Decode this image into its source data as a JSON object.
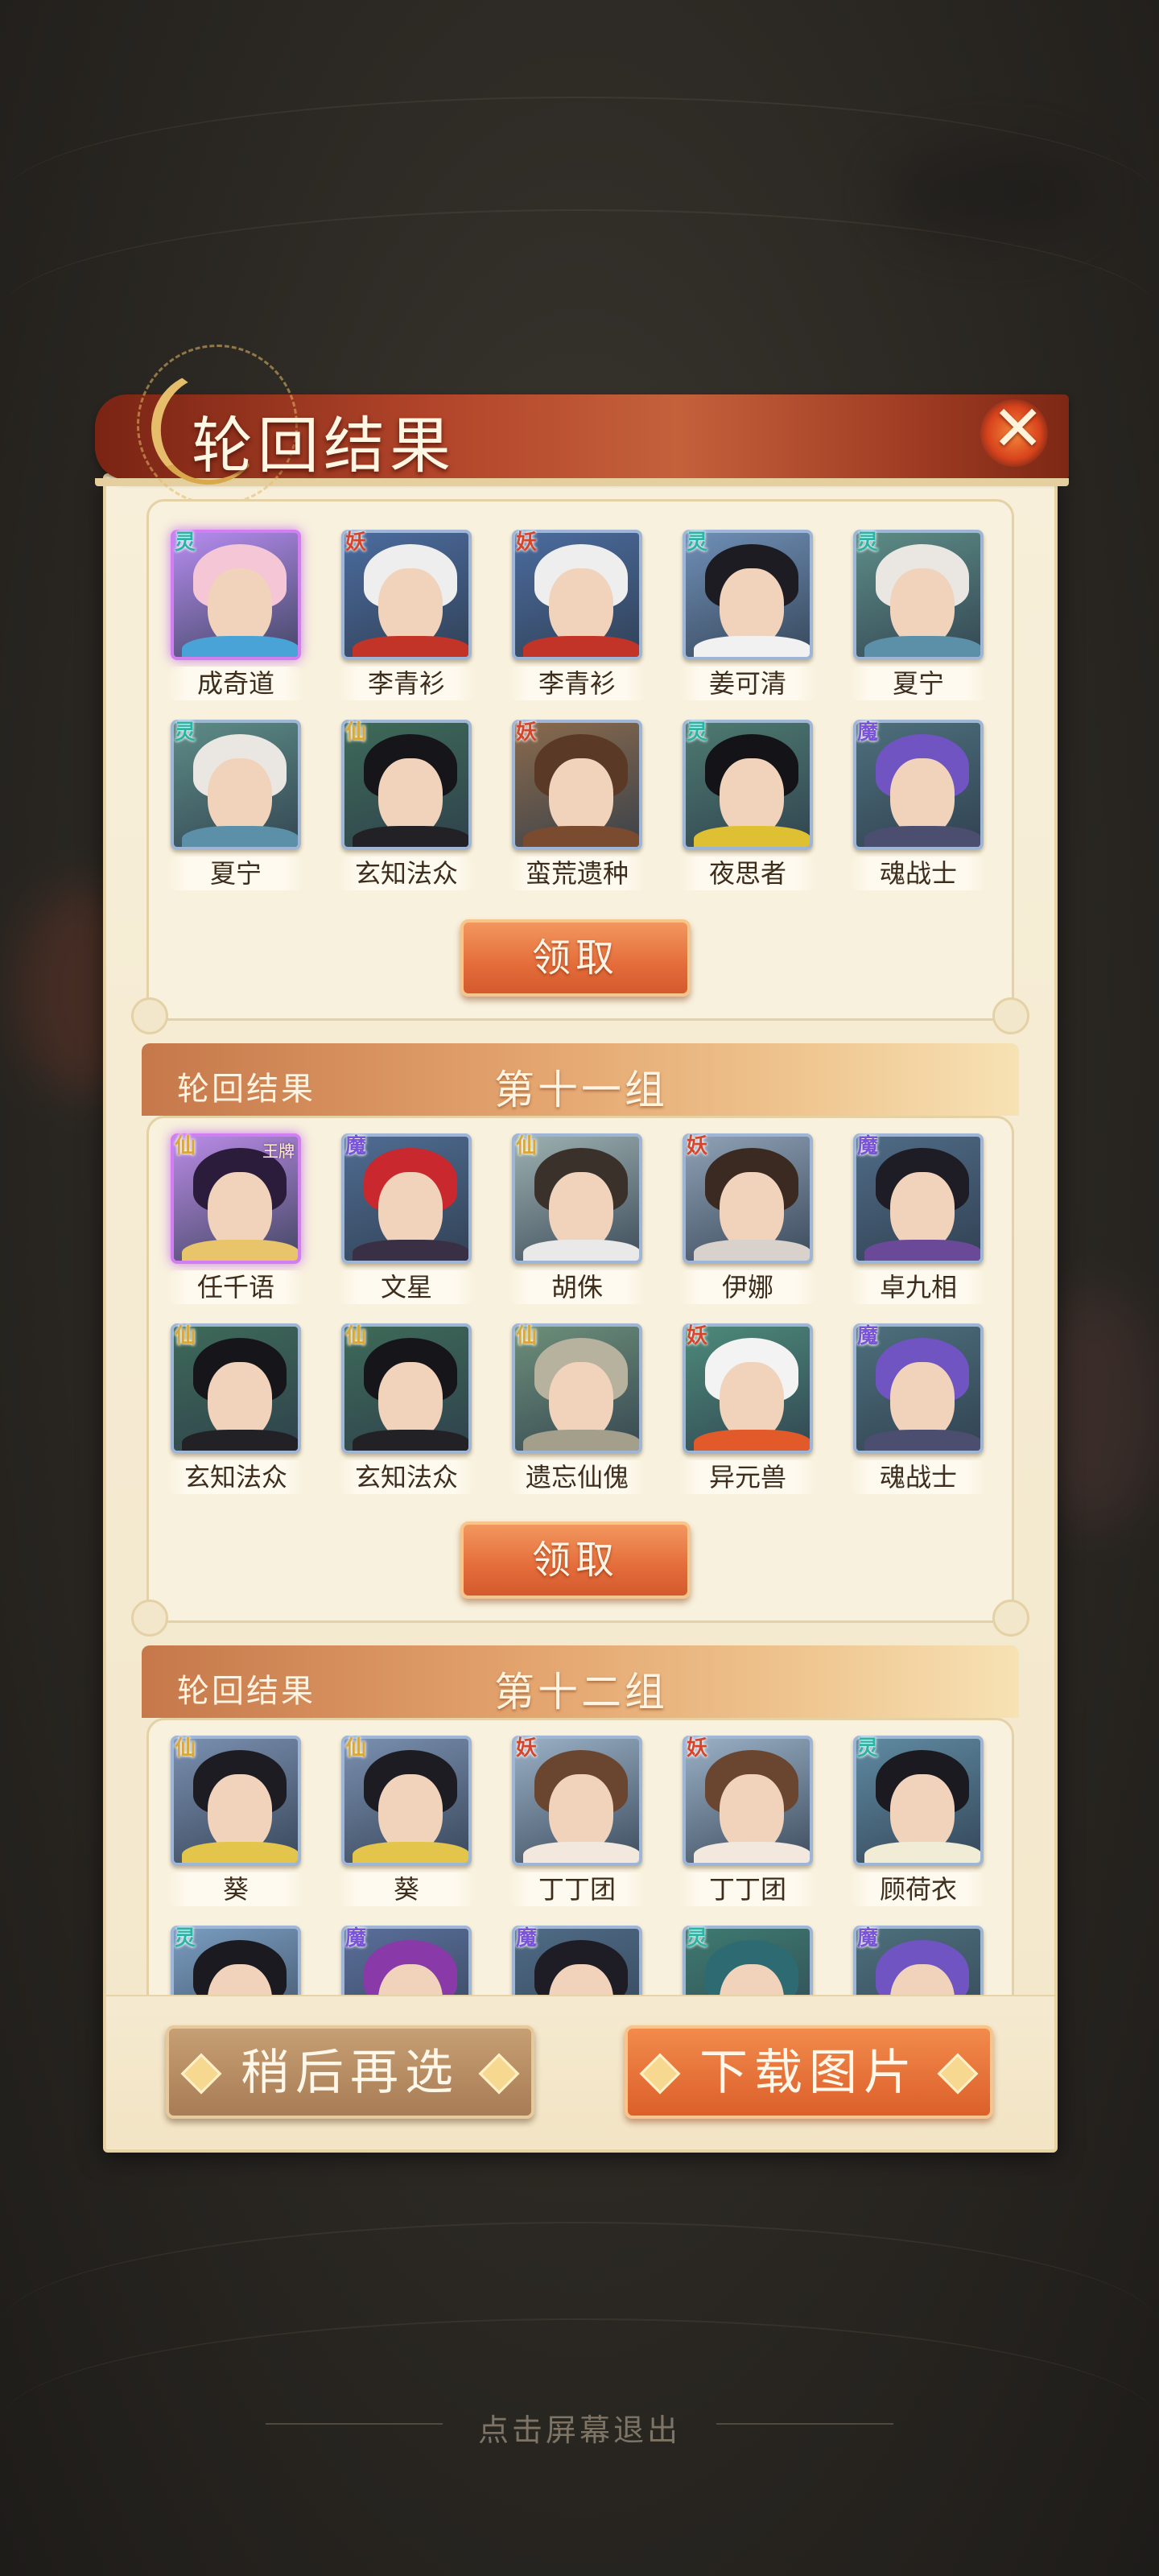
{
  "panel": {
    "title": "轮回结果"
  },
  "first_group": {
    "heroes": [
      {
        "name": "成奇道",
        "badge": "灵",
        "badge_color": "#2bb3a4",
        "selected": true,
        "hair": "#f4c6d6",
        "robe": "#4aa3d6",
        "bg": "#b68cf0"
      },
      {
        "name": "李青衫",
        "badge": "妖",
        "badge_color": "#d4452b",
        "selected": false,
        "hair": "#eeeeee",
        "robe": "#c23428",
        "bg": "#4b6b9e"
      },
      {
        "name": "李青衫",
        "badge": "妖",
        "badge_color": "#d4452b",
        "selected": false,
        "hair": "#eeeeee",
        "robe": "#c23428",
        "bg": "#4b6b9e"
      },
      {
        "name": "姜可清",
        "badge": "灵",
        "badge_color": "#2bb3a4",
        "selected": false,
        "hair": "#1c1c22",
        "robe": "#f1f1f1",
        "bg": "#6f8fb6"
      },
      {
        "name": "夏宁",
        "badge": "灵",
        "badge_color": "#2bb3a4",
        "selected": false,
        "hair": "#eae7e2",
        "robe": "#5c8fa8",
        "bg": "#5d8c86"
      },
      {
        "name": "夏宁",
        "badge": "灵",
        "badge_color": "#2bb3a4",
        "selected": false,
        "hair": "#eae7e2",
        "robe": "#5c8fa8",
        "bg": "#5d8c86"
      },
      {
        "name": "玄知法众",
        "badge": "仙",
        "badge_color": "#d8a93a",
        "selected": false,
        "hair": "#16161a",
        "robe": "#222226",
        "bg": "#3e6a58"
      },
      {
        "name": "蛮荒遗种",
        "badge": "妖",
        "badge_color": "#d4452b",
        "selected": false,
        "hair": "#5a3a26",
        "robe": "#7a4b2e",
        "bg": "#8a6a4c"
      },
      {
        "name": "夜思者",
        "badge": "灵",
        "badge_color": "#2bb3a4",
        "selected": false,
        "hair": "#141418",
        "robe": "#e0c033",
        "bg": "#4d7a70"
      },
      {
        "name": "魂战士",
        "badge": "魔",
        "badge_color": "#7a54d8",
        "selected": false,
        "hair": "#6f54c2",
        "robe": "#4c4e70",
        "bg": "#4d6f7c"
      }
    ],
    "claim_label": "领取"
  },
  "group_11": {
    "header_label": "轮回结果",
    "header_num": "第十一组",
    "heroes": [
      {
        "name": "任千语",
        "badge": "仙",
        "badge_color": "#d8a93a",
        "corner": "王牌",
        "selected": true,
        "hair": "#2a1c3a",
        "robe": "#e8c46a",
        "bg": "#b98be6"
      },
      {
        "name": "文星",
        "badge": "魔",
        "badge_color": "#7a54d8",
        "selected": false,
        "hair": "#c8282e",
        "robe": "#3a3046",
        "bg": "#4f6c92"
      },
      {
        "name": "胡侏",
        "badge": "仙",
        "badge_color": "#d8a93a",
        "selected": false,
        "hair": "#3a322a",
        "robe": "#e9e9e9",
        "bg": "#9cb0b0"
      },
      {
        "name": "伊娜",
        "badge": "妖",
        "badge_color": "#d4452b",
        "selected": false,
        "hair": "#3a2a22",
        "robe": "#d9d2cc",
        "bg": "#8fa1b6"
      },
      {
        "name": "卓九相",
        "badge": "魔",
        "badge_color": "#7a54d8",
        "selected": false,
        "hair": "#1e1c24",
        "robe": "#6a4a98",
        "bg": "#4f6b86"
      },
      {
        "name": "玄知法众",
        "badge": "仙",
        "badge_color": "#d8a93a",
        "selected": false,
        "hair": "#16161a",
        "robe": "#222226",
        "bg": "#3e6a58"
      },
      {
        "name": "玄知法众",
        "badge": "仙",
        "badge_color": "#d8a93a",
        "selected": false,
        "hair": "#16161a",
        "robe": "#222226",
        "bg": "#3e6a58"
      },
      {
        "name": "遗忘仙傀",
        "badge": "仙",
        "badge_color": "#d8a93a",
        "selected": false,
        "hair": "#b7b29e",
        "robe": "#a39f8a",
        "bg": "#6d8f7a"
      },
      {
        "name": "异元兽",
        "badge": "妖",
        "badge_color": "#d4452b",
        "selected": false,
        "hair": "#f3f3f3",
        "robe": "#e35a2a",
        "bg": "#4d8a7a"
      },
      {
        "name": "魂战士",
        "badge": "魔",
        "badge_color": "#7a54d8",
        "selected": false,
        "hair": "#6f54c2",
        "robe": "#4c4e70",
        "bg": "#4d6f7c"
      }
    ],
    "claim_label": "领取"
  },
  "group_12": {
    "header_label": "轮回结果",
    "header_num": "第十二组",
    "heroes": [
      {
        "name": "葵",
        "badge": "仙",
        "badge_color": "#d8a93a",
        "selected": false,
        "hair": "#1c1c22",
        "robe": "#e2c54a",
        "bg": "#7a8fb0"
      },
      {
        "name": "葵",
        "badge": "仙",
        "badge_color": "#d8a93a",
        "selected": false,
        "hair": "#1c1c22",
        "robe": "#e2c54a",
        "bg": "#7a8fb0"
      },
      {
        "name": "丁丁团",
        "badge": "妖",
        "badge_color": "#d4452b",
        "selected": false,
        "hair": "#6a4630",
        "robe": "#f3e8dd",
        "bg": "#9ab0c6"
      },
      {
        "name": "丁丁团",
        "badge": "妖",
        "badge_color": "#d4452b",
        "selected": false,
        "hair": "#6a4630",
        "robe": "#f3e8dd",
        "bg": "#9ab0c6"
      },
      {
        "name": "顾荷衣",
        "badge": "灵",
        "badge_color": "#2bb3a4",
        "selected": false,
        "hair": "#1a1a20",
        "robe": "#f0ecd6",
        "bg": "#5f8aa2"
      },
      {
        "name": "",
        "badge": "灵",
        "badge_color": "#2bb3a4",
        "selected": false,
        "hair": "#1a1a20",
        "robe": "#f0e6c0",
        "bg": "#7a9cc0"
      },
      {
        "name": "",
        "badge": "魔",
        "badge_color": "#7a54d8",
        "selected": false,
        "hair": "#8a3aa8",
        "robe": "#5a3a7a",
        "bg": "#5a6e9a"
      },
      {
        "name": "",
        "badge": "魔",
        "badge_color": "#7a54d8",
        "selected": false,
        "hair": "#1e1c24",
        "robe": "#6a4a98",
        "bg": "#4f6b86"
      },
      {
        "name": "",
        "badge": "灵",
        "badge_color": "#2bb3a4",
        "selected": false,
        "hair": "#2e6a72",
        "robe": "#4a8a8a",
        "bg": "#3e7a70"
      },
      {
        "name": "",
        "badge": "魔",
        "badge_color": "#7a54d8",
        "selected": false,
        "hair": "#6f54c2",
        "robe": "#4c4e70",
        "bg": "#4d6f7c"
      }
    ]
  },
  "footer": {
    "later_label": "稍后再选",
    "download_label": "下载图片",
    "exit_hint": "点击屏幕退出"
  },
  "colors": {
    "title_bar": "#b2452a",
    "accent_orange": "#e46c3a",
    "panel_bg": "#f7efd9"
  },
  "icons": {
    "close": "close-x-icon",
    "button_ornament": "diamond-ornament-icon"
  }
}
